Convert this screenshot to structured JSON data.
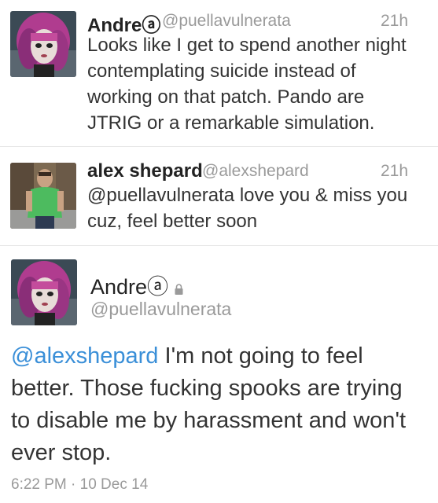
{
  "tweets": [
    {
      "display_name": "Andreⓐ",
      "handle": "@puellavulnerata",
      "time": "21h",
      "text": "Looks like I get to spend another night contemplating suicide instead of working on that patch.  Pando are JTRIG or a remarkable simulation."
    },
    {
      "display_name": "alex shepard",
      "handle": "@alexshepard",
      "time": "21h",
      "text": "@puellavulnerata love you & miss you cuz, feel better soon"
    }
  ],
  "detail": {
    "display_name": "Andreⓐ",
    "handle": "@puellavulnerata",
    "mention": "@alexshepard",
    "text": " I'm not going to feel better.  Those fucking spooks are trying to disable me by harassment and won't ever stop.",
    "timestamp": "6:22 PM · 10 Dec 14"
  },
  "icons": {
    "protected": "lock-icon"
  },
  "colors": {
    "mention": "#3a8fd8",
    "muted": "#9a9a9a"
  }
}
